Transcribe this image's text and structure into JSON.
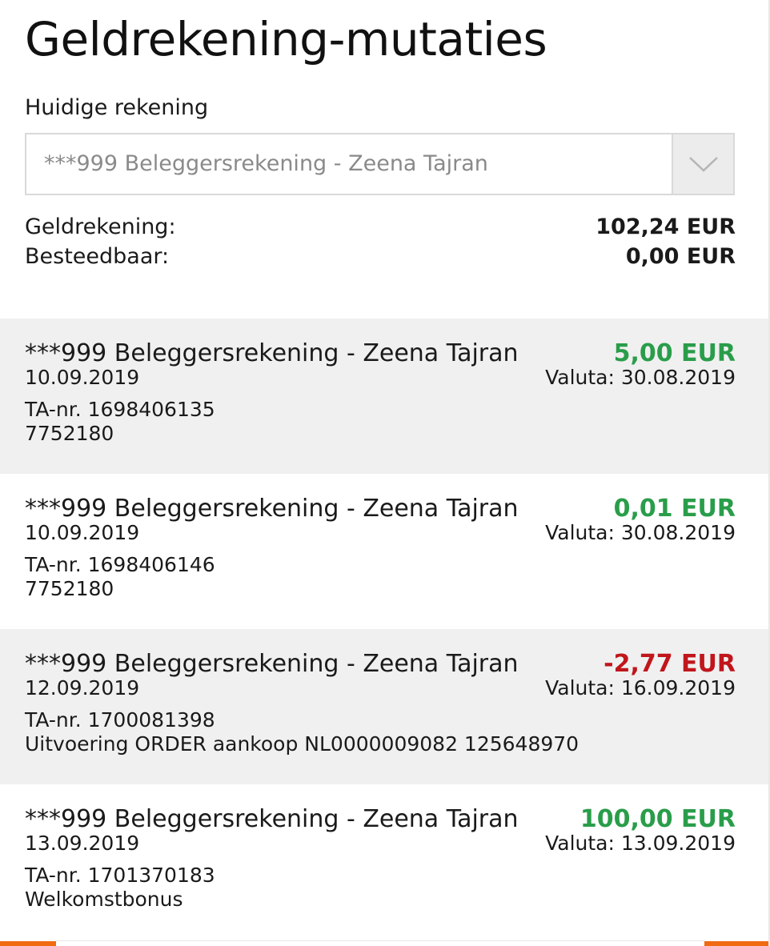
{
  "header": {
    "title": "Geldrekening-mutaties"
  },
  "account": {
    "label": "Huidige rekening",
    "selected": "***999 Beleggersrekening - Zeena Tajran"
  },
  "balances": {
    "geldrekening_label": "Geldrekening:",
    "geldrekening_amount": "102,24 EUR",
    "besteedbaar_label": "Besteedbaar:",
    "besteedbaar_amount": "0,00 EUR"
  },
  "transactions": [
    {
      "account": "***999 Beleggersrekening - Zeena Tajran",
      "amount": "5,00 EUR",
      "date": "10.09.2019",
      "valuta": "Valuta: 30.08.2019",
      "ta": "TA-nr. 1698406135",
      "description": "7752180"
    },
    {
      "account": "***999 Beleggersrekening - Zeena Tajran",
      "amount": "0,01 EUR",
      "date": "10.09.2019",
      "valuta": "Valuta: 30.08.2019",
      "ta": "TA-nr. 1698406146",
      "description": "7752180"
    },
    {
      "account": "***999 Beleggersrekening - Zeena Tajran",
      "amount": "-2,77 EUR",
      "date": "12.09.2019",
      "valuta": "Valuta: 16.09.2019",
      "ta": "TA-nr. 1700081398",
      "description": "Uitvoering ORDER aankoop NL0000009082 125648970"
    },
    {
      "account": "***999 Beleggersrekening - Zeena Tajran",
      "amount": "100,00 EUR",
      "date": "13.09.2019",
      "valuta": "Valuta: 13.09.2019",
      "ta": "TA-nr. 1701370183",
      "description": "Welkomstbonus"
    }
  ],
  "colors": {
    "positive": "#2a9d4a",
    "negative": "#c0161c",
    "accent": "#f06a12",
    "row_shade": "#f0f0f0"
  },
  "icons": {
    "dropdown": "chevron-down-icon"
  }
}
